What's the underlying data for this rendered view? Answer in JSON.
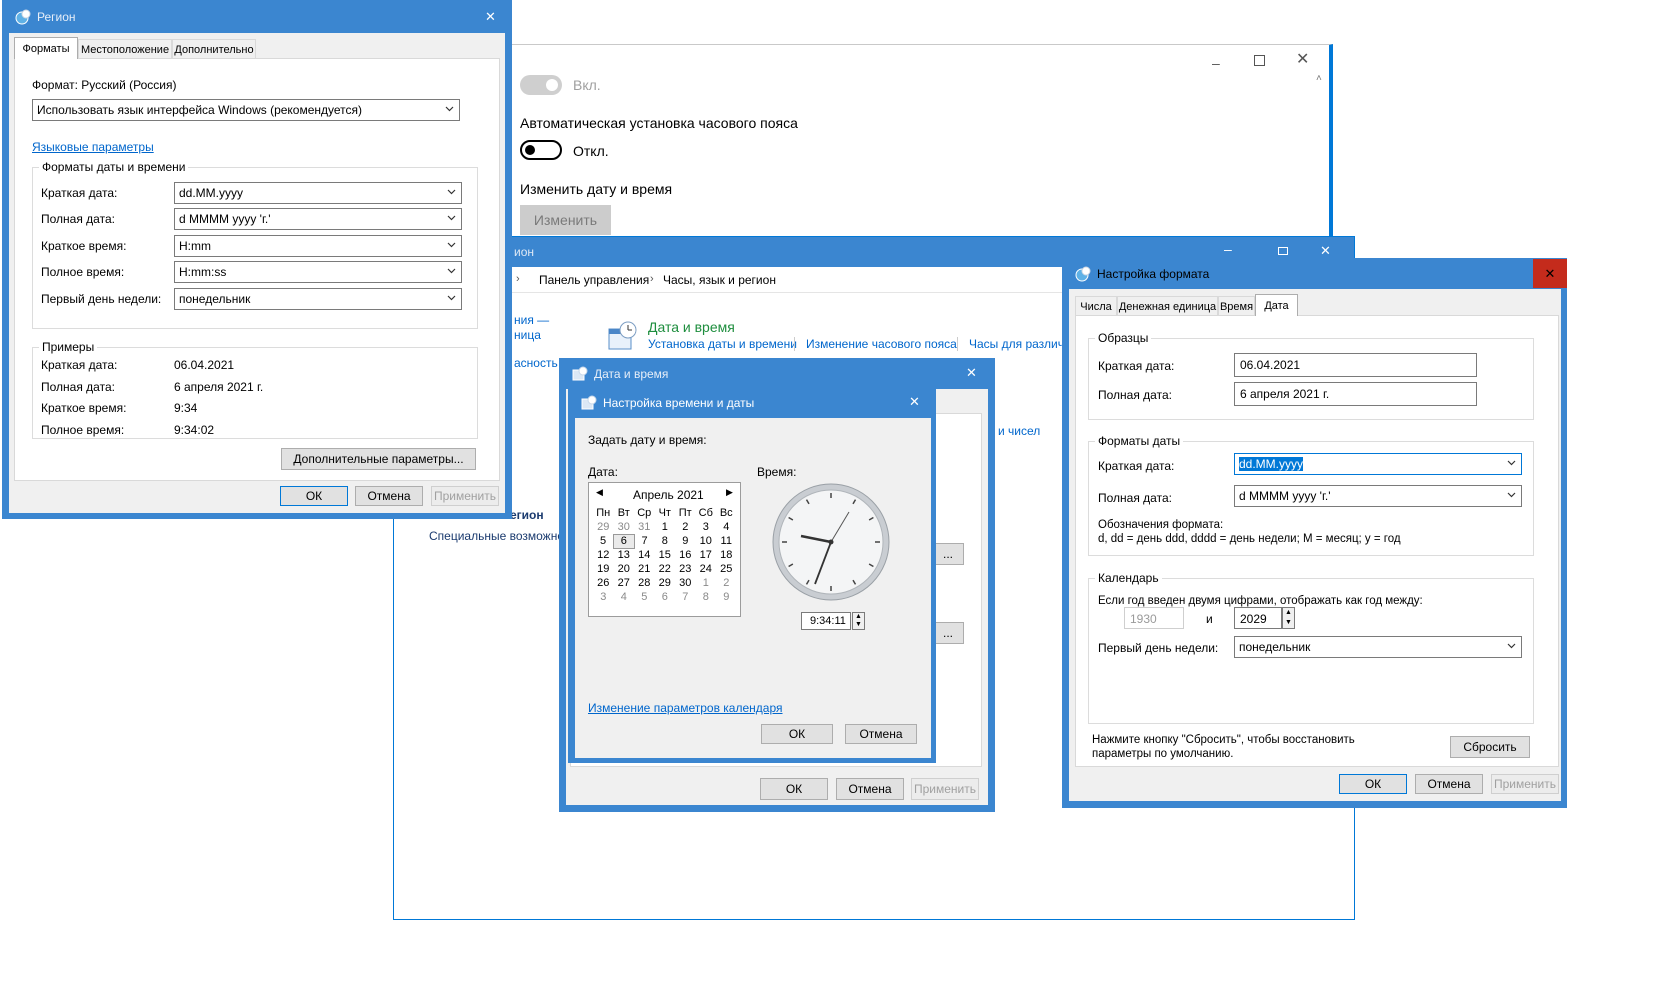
{
  "colors": {
    "accent": "#0078d7",
    "title_active": "#3b86d0",
    "link": "#0066cc"
  },
  "settings_window": {
    "toggle_on_label": "Вкл.",
    "auto_tz_heading": "Автоматическая установка часового пояса",
    "toggle_off_label": "Откл.",
    "change_datetime_heading": "Изменить дату и время",
    "change_button": "Изменить",
    "scroll_up": "˄"
  },
  "control_panel": {
    "title_fragment": "ион",
    "breadcrumb": [
      "Панель управления",
      "Часы, язык и регион"
    ],
    "left_fragments": [
      "ния —",
      "ница",
      "асность"
    ],
    "region_fragment": "егион",
    "accessibility_fragment": "Специальные возможно",
    "datetime_heading": "Дата и время",
    "datetime_links": [
      "Установка даты и времени",
      "Изменение часового пояса",
      "Часы для различн"
    ],
    "numbers_fragment": "и чисел",
    "btn_fragment": "..."
  },
  "region_dialog": {
    "title": "Регион",
    "tabs": [
      "Форматы",
      "Местоположение",
      "Дополнительно"
    ],
    "format_label": "Формат: Русский (Россия)",
    "format_value": "Использовать язык интерфейса Windows (рекомендуется)",
    "lang_link": "Языковые параметры",
    "group_formats": "Форматы даты и времени",
    "rows": [
      {
        "label": "Краткая дата:",
        "value": "dd.MM.yyyy"
      },
      {
        "label": "Полная дата:",
        "value": "d MMMM yyyy 'г.'"
      },
      {
        "label": "Краткое время:",
        "value": "H:mm"
      },
      {
        "label": "Полное время:",
        "value": "H:mm:ss"
      },
      {
        "label": "Первый день недели:",
        "value": "понедельник"
      }
    ],
    "group_examples": "Примеры",
    "examples": [
      {
        "label": "Краткая дата:",
        "value": "06.04.2021"
      },
      {
        "label": "Полная дата:",
        "value": "6 апреля 2021 г."
      },
      {
        "label": "Краткое время:",
        "value": "9:34"
      },
      {
        "label": "Полное время:",
        "value": "9:34:02"
      }
    ],
    "advanced_button": "Дополнительные параметры...",
    "ok": "ОК",
    "cancel": "Отмена",
    "apply": "Применить"
  },
  "datetime_dialog": {
    "title": "Дата и время",
    "ok": "ОК",
    "cancel": "Отмена",
    "apply": "Применить"
  },
  "set_time_dialog": {
    "title": "Настройка времени и даты",
    "instruction": "Задать дату и время:",
    "date_label": "Дата:",
    "time_label": "Время:",
    "month": "Апрель 2021",
    "weekdays": [
      "Пн",
      "Вт",
      "Ср",
      "Чт",
      "Пт",
      "Сб",
      "Вс"
    ],
    "weeks": [
      [
        "29",
        "30",
        "31",
        "1",
        "2",
        "3",
        "4"
      ],
      [
        "5",
        "6",
        "7",
        "8",
        "9",
        "10",
        "11"
      ],
      [
        "12",
        "13",
        "14",
        "15",
        "16",
        "17",
        "18"
      ],
      [
        "19",
        "20",
        "21",
        "22",
        "23",
        "24",
        "25"
      ],
      [
        "26",
        "27",
        "28",
        "29",
        "30",
        "1",
        "2"
      ],
      [
        "3",
        "4",
        "5",
        "6",
        "7",
        "8",
        "9"
      ]
    ],
    "time_value": "9:34:11",
    "calendar_link": "Изменение параметров календаря",
    "ok": "ОК",
    "cancel": "Отмена"
  },
  "format_dialog": {
    "title": "Настройка формата",
    "tabs": [
      "Числа",
      "Денежная единица",
      "Время",
      "Дата"
    ],
    "group_samples": "Образцы",
    "short_date_label": "Краткая дата:",
    "short_date_sample": "06.04.2021",
    "long_date_label": "Полная дата:",
    "long_date_sample": "6 апреля 2021 г.",
    "group_formats": "Форматы даты",
    "short_date_format": "dd.MM.yyyy",
    "long_date_format": "d MMMM yyyy 'г.'",
    "notation_title": "Обозначения формата:",
    "notation_text": "d, dd = день  ddd, dddd = день недели; M = месяц; y = год",
    "group_calendar": "Календарь",
    "two_digit_text": "Если год введен двумя цифрами, отображать как год между:",
    "year_from": "1930",
    "and_label": "и",
    "year_to": "2029",
    "first_day_label": "Первый день недели:",
    "first_day_value": "понедельник",
    "reset_text": "Нажмите кнопку \"Сбросить\", чтобы восстановить параметры по умолчанию.",
    "reset_button": "Сбросить",
    "ok": "ОК",
    "cancel": "Отмена",
    "apply": "Применить"
  }
}
